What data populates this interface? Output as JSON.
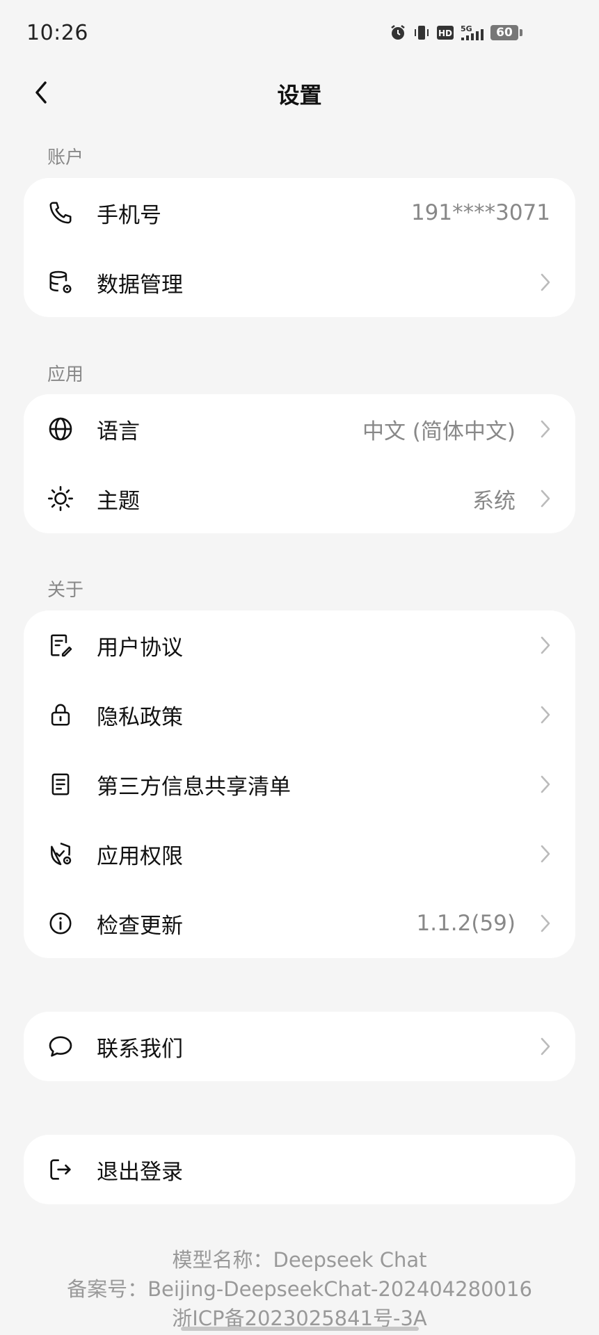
{
  "status_bar": {
    "time": "10:26",
    "icons": [
      "alarm-icon",
      "vibrate-icon",
      "hd-icon",
      "5g-signal-icon"
    ],
    "battery_level": "60"
  },
  "header": {
    "title": "设置",
    "back_icon": "chevron-left-icon"
  },
  "sections": {
    "account": {
      "label": "账户",
      "items": [
        {
          "icon": "phone-icon",
          "label": "手机号",
          "value": "191****3071"
        },
        {
          "icon": "database-gear-icon",
          "label": "数据管理"
        }
      ]
    },
    "app": {
      "label": "应用",
      "items": [
        {
          "icon": "globe-icon",
          "label": "语言",
          "value": "中文 (简体中文)"
        },
        {
          "icon": "sun-icon",
          "label": "主题",
          "value": "系统"
        }
      ]
    },
    "about": {
      "label": "关于",
      "items": [
        {
          "icon": "document-edit-icon",
          "label": "用户协议"
        },
        {
          "icon": "lock-icon",
          "label": "隐私政策"
        },
        {
          "icon": "list-document-icon",
          "label": "第三方信息共享清单"
        },
        {
          "icon": "shield-gear-icon",
          "label": "应用权限"
        },
        {
          "icon": "info-icon",
          "label": "检查更新",
          "value": "1.1.2(59)"
        }
      ]
    },
    "contact": {
      "items": [
        {
          "icon": "chat-bubble-icon",
          "label": "联系我们"
        }
      ]
    },
    "logout": {
      "items": [
        {
          "icon": "logout-icon",
          "label": "退出登录"
        }
      ]
    }
  },
  "footer": {
    "model_name": "模型名称：Deepseek Chat",
    "filing_number": "备案号：Beijing-DeepseekChat-202404280016",
    "icp": "浙ICP备2023025841号-3A"
  },
  "colors": {
    "background": "#f5f5f5",
    "card": "#ffffff",
    "text_primary": "#111111",
    "text_secondary": "#888888"
  }
}
